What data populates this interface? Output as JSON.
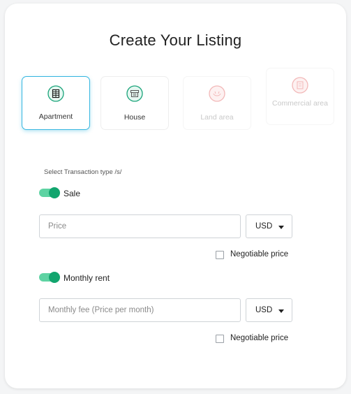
{
  "page": {
    "title": "Create Your Listing"
  },
  "property_types": [
    {
      "label": "Apartment",
      "icon": "apartment-icon",
      "state": "selected"
    },
    {
      "label": "House",
      "icon": "house-icon",
      "state": "enabled"
    },
    {
      "label": "Land area",
      "icon": "land-area-icon",
      "state": "disabled"
    },
    {
      "label": "Commercial area",
      "icon": "commercial-area-icon",
      "state": "disabled"
    }
  ],
  "transaction": {
    "label": "Select Transaction type /s/",
    "sale": {
      "toggle_label": "Sale",
      "enabled": true,
      "price_value": "",
      "price_placeholder": "Price",
      "currency": "USD",
      "negotiable_label": "Negotiable price",
      "negotiable_checked": false
    },
    "rent": {
      "toggle_label": "Monthly rent",
      "enabled": true,
      "fee_value": "",
      "fee_placeholder": "Monthly fee (Price per month)",
      "currency": "USD",
      "negotiable_label": "Negotiable price",
      "negotiable_checked": false
    }
  },
  "colors": {
    "selected_border": "#35b6e0",
    "icon_active": "#1aa47a",
    "icon_disabled": "#f2b8b8",
    "toggle_track": "#5ed3a3",
    "toggle_knob": "#12a56e"
  }
}
